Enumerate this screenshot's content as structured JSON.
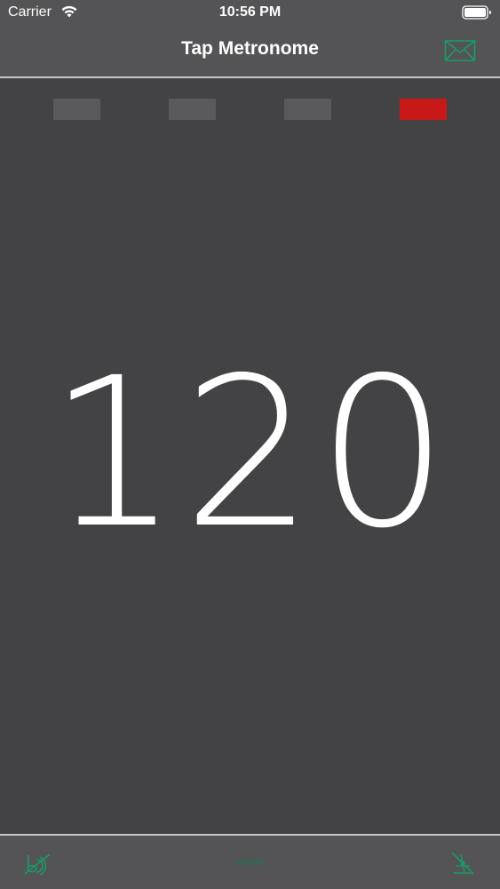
{
  "status_bar": {
    "carrier": "Carrier",
    "time": "10:56 PM"
  },
  "nav": {
    "title": "Tap Metronome",
    "mail_icon": "envelope-icon"
  },
  "beats": {
    "count": 4,
    "active_index": 4,
    "active_color": "#c81818",
    "inactive_color": "#5a595b"
  },
  "tempo": {
    "bpm": "120"
  },
  "toolbar": {
    "left_icon": "sound-muted-icon",
    "center_icon": "dots-icon",
    "right_icon": "metronome-icon",
    "accent_color": "#1a9a68"
  }
}
